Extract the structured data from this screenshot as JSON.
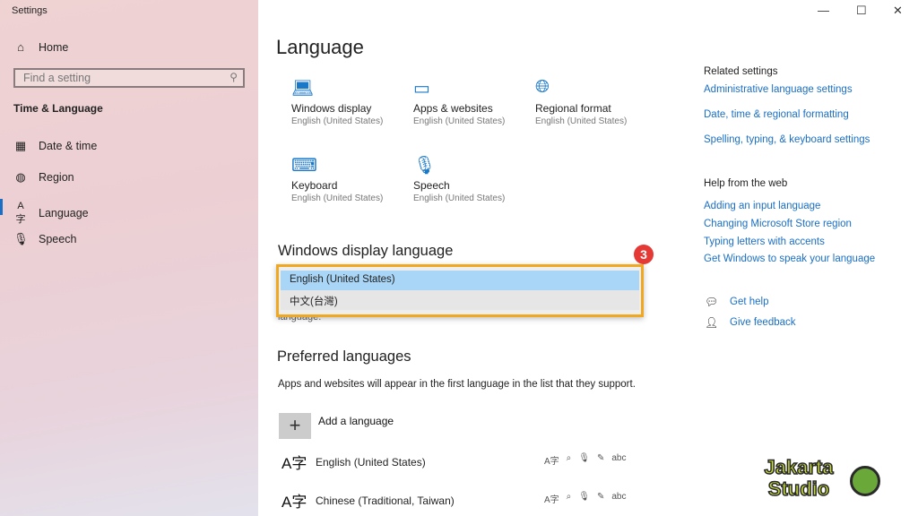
{
  "window": {
    "title": "Settings",
    "minimize": "—",
    "maximize": "☐",
    "close": "✕"
  },
  "sidebar": {
    "home": "Home",
    "search_placeholder": "Find a setting",
    "section": "Time & Language",
    "items": [
      {
        "label": "Date & time",
        "icon": "calendar-clock-icon"
      },
      {
        "label": "Region",
        "icon": "globe-icon"
      },
      {
        "label": "Language",
        "icon": "language-icon",
        "selected": true
      },
      {
        "label": "Speech",
        "icon": "microphone-icon"
      }
    ]
  },
  "main": {
    "title": "Language",
    "tiles": [
      {
        "title": "Windows display",
        "sub": "English (United States)",
        "icon": "laptop-icon"
      },
      {
        "title": "Apps & websites",
        "sub": "English (United States)",
        "icon": "window-icon"
      },
      {
        "title": "Regional format",
        "sub": "English (United States)",
        "icon": "globe-icon"
      },
      {
        "title": "Keyboard",
        "sub": "English (United States)",
        "icon": "keyboard-icon"
      },
      {
        "title": "Speech",
        "sub": "English (United States)",
        "icon": "microphone-icon"
      }
    ],
    "display_language": {
      "heading": "Windows display language",
      "options": [
        "English (United States)",
        "中文(台灣)"
      ],
      "selected": "English (United States)",
      "hidden_text": "language."
    },
    "badge": "3",
    "preferred": {
      "heading": "Preferred languages",
      "description": "Apps and websites will appear in the first language in the list that they support.",
      "add_label": "Add a language",
      "languages": [
        "English (United States)",
        "Chinese (Traditional, Taiwan)"
      ]
    }
  },
  "related": {
    "heading": "Related settings",
    "links": [
      "Administrative language settings",
      "Date, time & regional formatting",
      "Spelling, typing, & keyboard settings"
    ]
  },
  "help": {
    "heading": "Help from the web",
    "links": [
      "Adding an input language",
      "Changing Microsoft Store region",
      "Typing letters with accents",
      "Get Windows to speak your language"
    ],
    "get_help": "Get help",
    "feedback": "Give feedback"
  },
  "watermark": {
    "text": "Jakarta Studio"
  },
  "colors": {
    "accent": "#1a6fc4",
    "highlight": "#f0a820",
    "badge": "#e53935"
  }
}
